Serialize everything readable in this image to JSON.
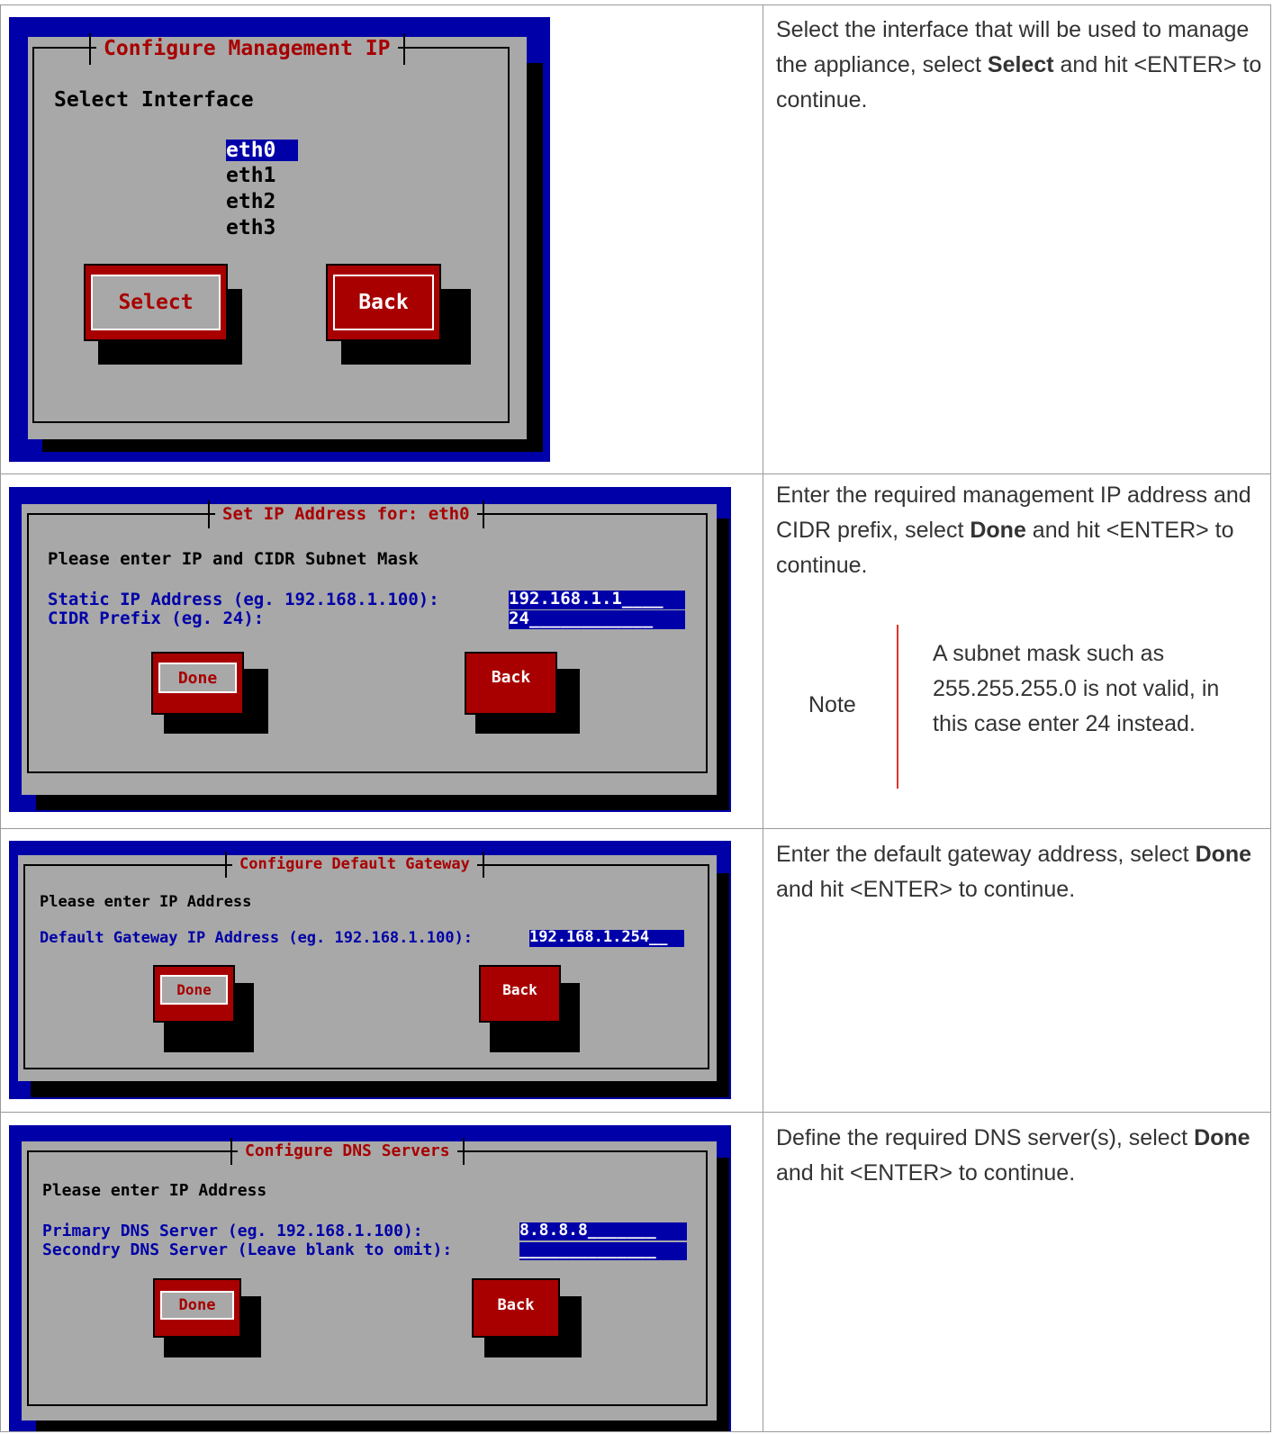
{
  "rows": [
    {
      "dialog_title": "Configure Management IP",
      "prompt": "Select Interface",
      "interfaces": [
        "eth0",
        "eth1",
        "eth2",
        "eth3"
      ],
      "selected_interface": "eth0",
      "buttons": [
        "Select",
        "Back"
      ],
      "description": {
        "before": "Select the interface that will be used to manage the appliance, select ",
        "bold": "Select",
        "after": " and hit <ENTER> to continue."
      }
    },
    {
      "dialog_title": "Set IP Address for: eth0",
      "prompt": "Please enter IP and CIDR Subnet Mask",
      "field_labels": [
        "Static IP Address (eg. 192.168.1.100):",
        "CIDR Prefix (eg. 24):"
      ],
      "field_values": [
        "192.168.1.1____",
        "24____________"
      ],
      "buttons": [
        "Done",
        "Back"
      ],
      "description": {
        "before": "Enter the required management IP address and CIDR prefix, select ",
        "bold": "Done",
        "after": " and hit <ENTER> to continue."
      },
      "note": {
        "label": "Note",
        "text": "A subnet mask such as 255.255.255.0 is not valid, in this case enter 24 instead."
      }
    },
    {
      "dialog_title": "Configure Default Gateway",
      "prompt": "Please enter IP Address",
      "field_labels": [
        "Default Gateway IP Address (eg. 192.168.1.100):"
      ],
      "field_values": [
        "192.168.1.254__"
      ],
      "buttons": [
        "Done",
        "Back"
      ],
      "description": {
        "before": "Enter the default gateway address, select ",
        "bold": "Done",
        "after": " and hit <ENTER> to continue."
      }
    },
    {
      "dialog_title": "Configure DNS Servers",
      "prompt": "Please enter IP Address",
      "field_labels": [
        "Primary DNS Server (eg. 192.168.1.100):",
        "Secondry DNS Server (Leave blank to omit):"
      ],
      "field_values": [
        "8.8.8.8_______",
        "______________"
      ],
      "buttons": [
        "Done",
        "Back"
      ],
      "description": {
        "before": "Define the required DNS server(s), select ",
        "bold": "Done",
        "after": " and hit <ENTER> to continue."
      }
    }
  ],
  "colors": {
    "terminal_blue": "#0000a8",
    "dialog_gray": "#a8a8a8",
    "button_red": "#a80000",
    "note_bar": "#e0332c"
  }
}
